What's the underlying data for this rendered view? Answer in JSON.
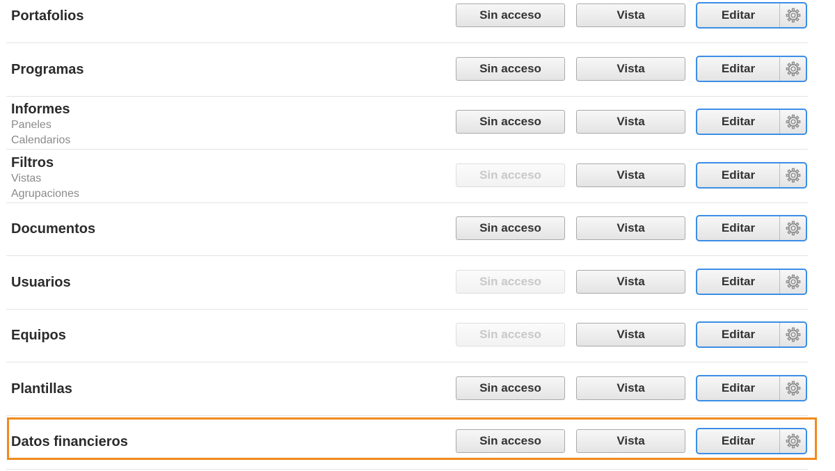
{
  "buttons": {
    "no_access": "Sin acceso",
    "view": "Vista",
    "edit": "Editar",
    "settings_icon": "gear-icon"
  },
  "colors": {
    "edit_border": "#3a8ee6",
    "highlight_border": "#f08a1c",
    "title_text": "#2b2b2b",
    "sub_text": "#8a8a8a"
  },
  "rows": [
    {
      "title": "Portafolios",
      "subtitles": [],
      "no_access_enabled": true
    },
    {
      "title": "Programas",
      "subtitles": [],
      "no_access_enabled": true
    },
    {
      "title": "Informes",
      "subtitles": [
        "Paneles",
        "Calendarios"
      ],
      "no_access_enabled": true
    },
    {
      "title": "Filtros",
      "subtitles": [
        "Vistas",
        "Agrupaciones"
      ],
      "no_access_enabled": false
    },
    {
      "title": "Documentos",
      "subtitles": [],
      "no_access_enabled": true
    },
    {
      "title": "Usuarios",
      "subtitles": [],
      "no_access_enabled": false
    },
    {
      "title": "Equipos",
      "subtitles": [],
      "no_access_enabled": false
    },
    {
      "title": "Plantillas",
      "subtitles": [],
      "no_access_enabled": true
    },
    {
      "title": "Datos financieros",
      "subtitles": [],
      "no_access_enabled": true,
      "highlighted": true
    }
  ]
}
